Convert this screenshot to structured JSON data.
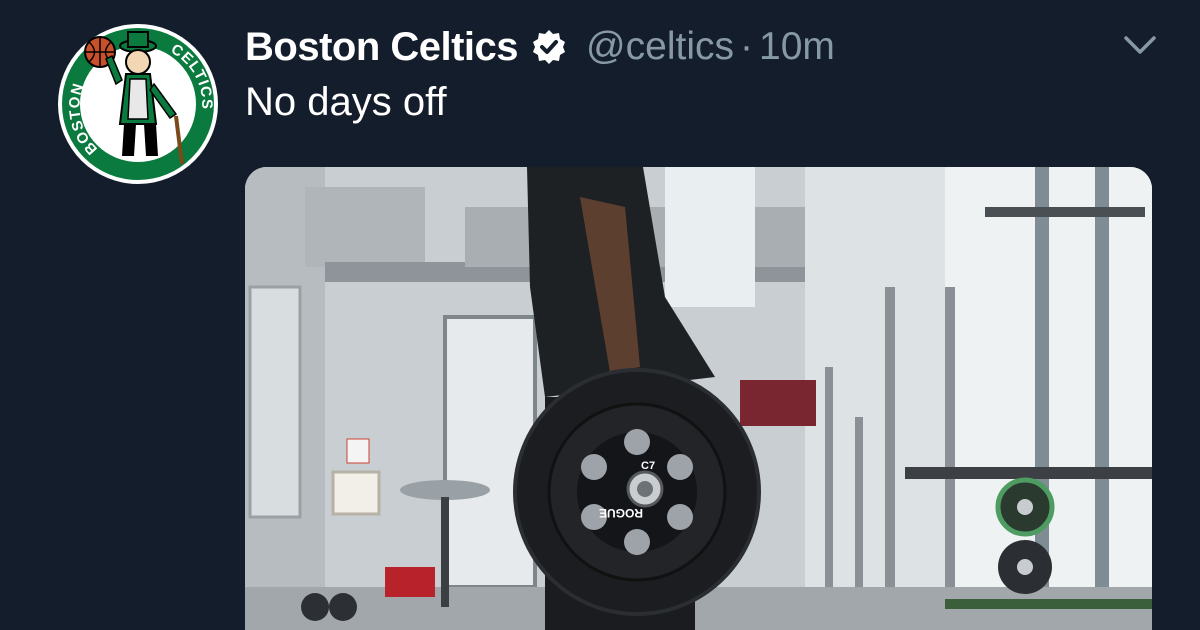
{
  "tweet": {
    "display_name": "Boston Celtics",
    "handle": "@celtics",
    "separator": "·",
    "time": "10m",
    "text": "No days off"
  },
  "avatar": {
    "logo_text_left": "BOSTON",
    "logo_text_right": "CELTICS"
  },
  "media": {
    "plate_brand": "ROGUE",
    "plate_label": "C7"
  },
  "icons": {
    "verified": "verified-badge-icon",
    "more": "chevron-down-icon"
  },
  "colors": {
    "background": "#141d2b",
    "secondary_text": "#8899a6",
    "celtics_green": "#0a7a3c"
  }
}
